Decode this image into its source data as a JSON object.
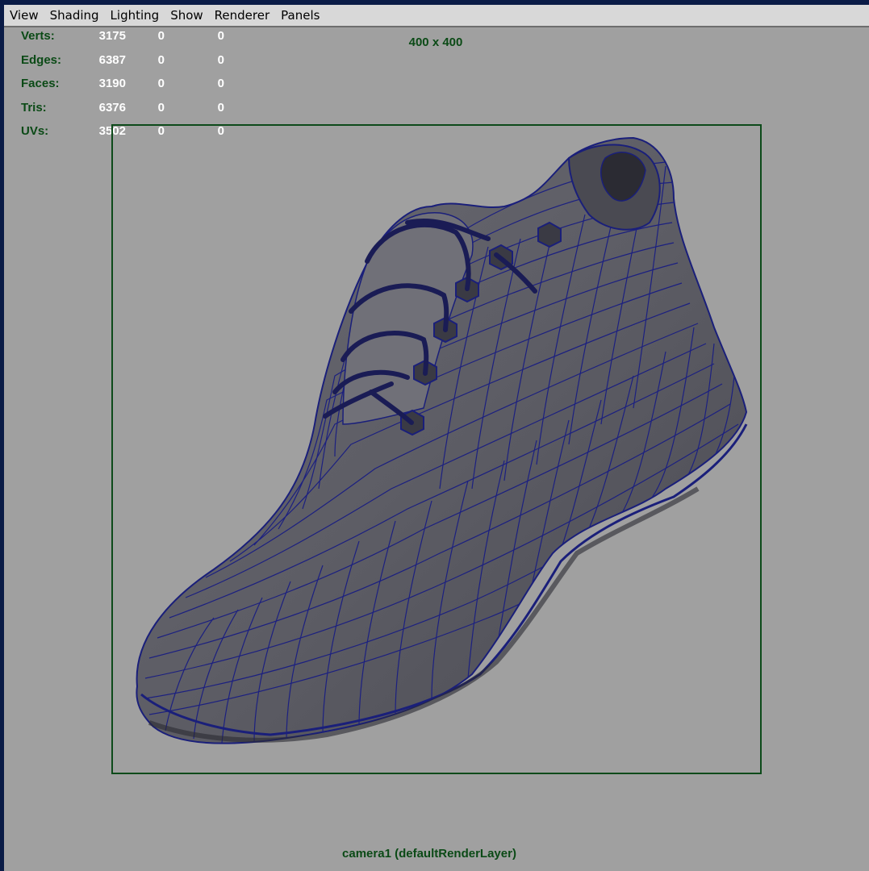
{
  "menubar": {
    "items": [
      "View",
      "Shading",
      "Lighting",
      "Show",
      "Renderer",
      "Panels"
    ]
  },
  "hud": {
    "rows": [
      {
        "label": "Verts:",
        "values": [
          "3175",
          "0",
          "0"
        ]
      },
      {
        "label": "Edges:",
        "values": [
          "6387",
          "0",
          "0"
        ]
      },
      {
        "label": "Faces:",
        "values": [
          "3190",
          "0",
          "0"
        ]
      },
      {
        "label": "Tris:",
        "values": [
          "6376",
          "0",
          "0"
        ]
      },
      {
        "label": "UVs:",
        "values": [
          "3502",
          "0",
          "0"
        ]
      }
    ]
  },
  "resolution_gate": {
    "label": "400 x 400"
  },
  "camera": {
    "label": "camera1 (defaultRenderLayer)"
  },
  "colors": {
    "viewport_bg": "#a0a0a0",
    "hud_label": "#0b4a16",
    "hud_value": "#ffffff",
    "wireframe": "#1a1f7a",
    "shoe_fill": "#5e5e66",
    "frame": "#0a1b46"
  }
}
